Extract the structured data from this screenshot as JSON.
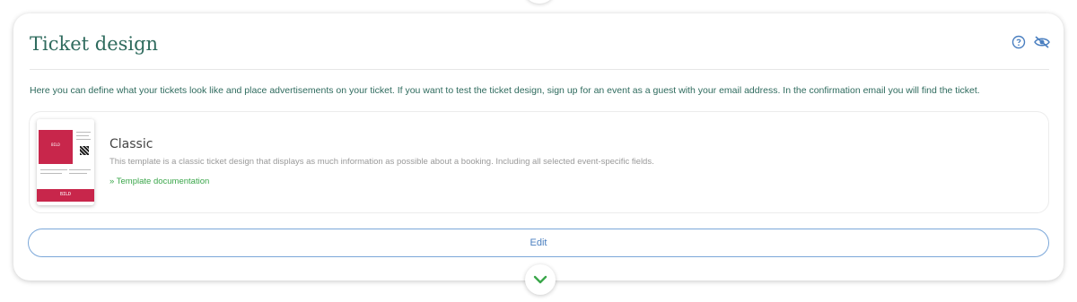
{
  "section": {
    "title": "Ticket design",
    "description": "Here you can define what your tickets look like and place advertisements on your ticket. If you want to test the ticket design, sign up for an event as a guest with your email address. In the confirmation email you will find the ticket."
  },
  "icons": {
    "help": "help-circle-icon",
    "visibility": "eye-off-icon",
    "expand": "chevron-down-icon"
  },
  "template": {
    "name": "Classic",
    "description": "This template is a classic ticket design that displays as much information as possible about a booking. Including all selected event-specific fields.",
    "link_label": "» Template documentation",
    "thumbnail_text_top": "BILD",
    "thumbnail_text_bottom": "BILD"
  },
  "actions": {
    "edit_label": "Edit"
  },
  "colors": {
    "title": "#2f6b5e",
    "accent_blue": "#4a7fc0",
    "link_green": "#3aa64a",
    "ticket_red": "#c8264b"
  }
}
